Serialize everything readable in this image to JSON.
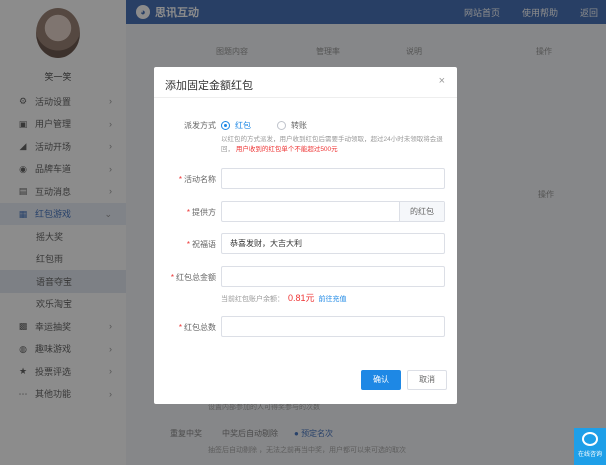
{
  "user": {
    "name": "笑一笑"
  },
  "sidebar": {
    "items": [
      {
        "label": "活动设置",
        "icon": "gear-icon",
        "glyph": "⚙"
      },
      {
        "label": "用户管理",
        "icon": "user-card-icon",
        "glyph": "▣"
      },
      {
        "label": "活动开场",
        "icon": "megaphone-icon",
        "glyph": "◢"
      },
      {
        "label": "品牌车道",
        "icon": "brand-icon",
        "glyph": "◉"
      },
      {
        "label": "互动消息",
        "icon": "message-icon",
        "glyph": "▤"
      },
      {
        "label": "红包游戏",
        "icon": "red-packet-icon",
        "glyph": "▦"
      }
    ],
    "sub_items": [
      {
        "label": "摇大奖"
      },
      {
        "label": "红包雨"
      },
      {
        "label": "语音夺宝"
      },
      {
        "label": "欢乐淘宝"
      }
    ],
    "items_after": [
      {
        "label": "幸运抽奖",
        "icon": "grid-icon",
        "glyph": "▩"
      },
      {
        "label": "趣味游戏",
        "icon": "gamepad-icon",
        "glyph": "◍"
      },
      {
        "label": "投票评选",
        "icon": "star-icon",
        "glyph": "★"
      },
      {
        "label": "其他功能",
        "icon": "more-icon",
        "glyph": "⋯"
      }
    ]
  },
  "header": {
    "logo_text": "思讯互动",
    "links": [
      "网站首页",
      "使用帮助",
      "返回"
    ]
  },
  "background": {
    "table_headers": [
      "图题内容",
      "管理率",
      "说明",
      "操作"
    ],
    "side_label": "操作",
    "hint_text": "设置内部参加的人可得奖参与的次数",
    "repeat_label": "重复中奖",
    "repeat_opt1": "中奖后自动剔除",
    "repeat_opt2": "预定名次",
    "repeat_note": "抽签后自动剔除 ，无法之前再当中奖，用户都可以来可选的取次"
  },
  "modal": {
    "title": "添加固定金额红包",
    "issue_method_label": "派发方式",
    "options": [
      "红包",
      "转账"
    ],
    "note_text": "以红包的方式派发，用户收到红包后需要手动领取，超过24小时未领取将会退回，",
    "note_warning": "用户收到的红包单个不能超过500元",
    "fields": {
      "activity_name_label": "活动名称",
      "activity_name_value": "",
      "provider_label": "提供方",
      "provider_value": "",
      "provider_suffix": "的红包",
      "greeting_label": "祝福语",
      "greeting_value": "恭喜发财，大吉大利",
      "total_amount_label": "红包总金额",
      "total_amount_value": "",
      "total_count_label": "红包总数",
      "total_count_value": ""
    },
    "balance_label": "当前红包账户余额：",
    "balance_amount": "0.81元",
    "recharge_link": "前往充值",
    "confirm_label": "确认",
    "cancel_label": "取消"
  },
  "float_chat": {
    "label": "在线咨询"
  }
}
